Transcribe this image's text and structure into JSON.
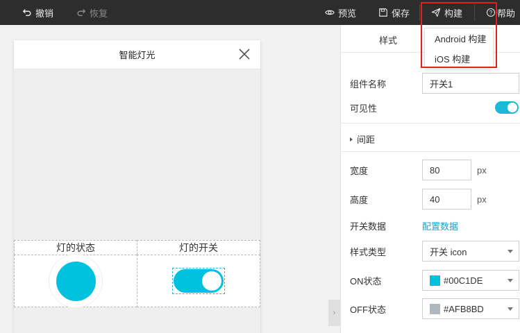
{
  "toolbar": {
    "undo_label": "撤销",
    "redo_label": "恢复",
    "preview_label": "预览",
    "save_label": "保存",
    "build_label": "构建",
    "help_label": "帮助"
  },
  "build_menu": {
    "items": [
      {
        "label": "Android 构建"
      },
      {
        "label": "iOS 构建"
      }
    ]
  },
  "phone": {
    "title": "智能灯光",
    "table_headers": [
      "灯的状态",
      "灯的开关"
    ],
    "lamp_color": "#00C1DE",
    "switch_color": "#00C1DE",
    "switch_state": "on"
  },
  "panel": {
    "tab_style": "样式",
    "component_name_label": "组件名称",
    "component_name_value": "开关1",
    "visibility_label": "可见性",
    "visibility_on": true,
    "spacing_section": "间距",
    "width_label": "宽度",
    "width_value": "80",
    "height_label": "高度",
    "height_value": "40",
    "unit": "px",
    "switch_data_label": "开关数据",
    "switch_data_link": "配置数据",
    "style_type_label": "样式类型",
    "style_type_value": "开关 icon",
    "on_state_label": "ON状态",
    "on_state_color": "#00C1DE",
    "off_state_label": "OFF状态",
    "off_state_color": "#AFB8BD"
  },
  "colors": {
    "accent": "#00C1DE",
    "toggle_on": "#1bb8d8",
    "highlight_box": "#e0211c"
  }
}
